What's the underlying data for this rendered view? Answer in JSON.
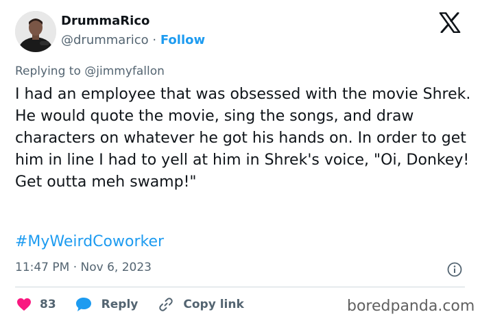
{
  "author": {
    "name": "DrummaRico",
    "handle": "@drummarico",
    "separator": "·",
    "follow_label": "Follow"
  },
  "reply_context": {
    "prefix": "Replying to",
    "target": "@jimmyfallon"
  },
  "tweet": {
    "text": "I had an employee that was obsessed with the movie Shrek. He would quote the movie, sing the songs, and draw characters on whatever he got his hands on. In order to get him in line I had to yell at him in Shrek's voice, \"Oi, Donkey! Get outta meh swamp!\"",
    "hashtag": "#MyWeirdCoworker",
    "timestamp": "11:47 PM · Nov 6, 2023"
  },
  "actions": {
    "like_count": "83",
    "reply_label": "Reply",
    "copy_link_label": "Copy link"
  },
  "icons": {
    "platform": "x-logo-icon",
    "info": "info-icon",
    "like": "heart-icon",
    "reply": "speech-bubble-icon",
    "copy_link": "link-icon"
  },
  "colors": {
    "accent": "#1d9bf0",
    "heart": "#f91880",
    "secondary_text": "#536471"
  },
  "watermark": "boredpanda.com"
}
